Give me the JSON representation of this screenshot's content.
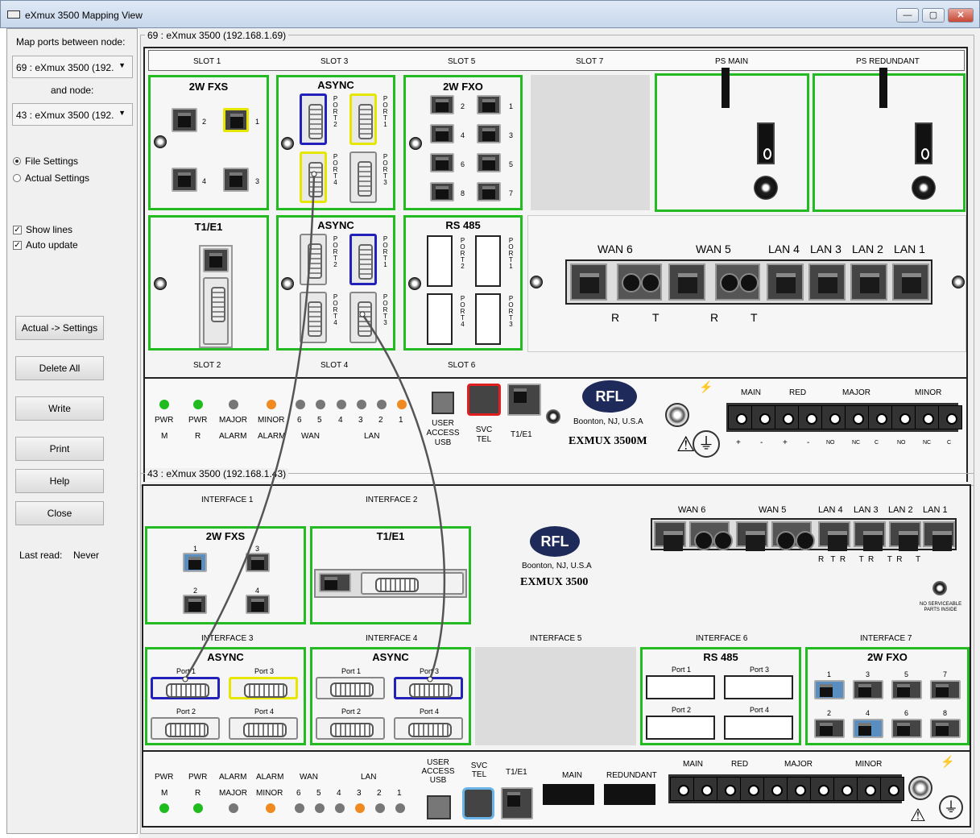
{
  "window": {
    "title": "eXmux 3500 Mapping View",
    "min": "—",
    "max": "▢",
    "close": "✕"
  },
  "left": {
    "map_label": "Map ports between node:",
    "node1": "69 : eXmux 3500 (192.",
    "and_label": "and node:",
    "node2": "43 : eXmux 3500 (192.",
    "radio_file": "File Settings",
    "radio_actual": "Actual Settings",
    "show_lines": "Show lines",
    "auto_update": "Auto update",
    "btn_actual": "Actual -> Settings",
    "btn_delete": "Delete All",
    "btn_write": "Write",
    "btn_print": "Print",
    "btn_help": "Help",
    "btn_close": "Close",
    "last_read_label": "Last read:",
    "last_read_value": "Never"
  },
  "top": {
    "group": "69 : eXmux 3500 (192.168.1.69)",
    "slots": {
      "s1": "SLOT 1",
      "s3": "SLOT 3",
      "s5": "SLOT 5",
      "s7": "SLOT 7",
      "ps_main": "PS MAIN",
      "ps_red": "PS REDUNDANT",
      "s2": "SLOT 2",
      "s4": "SLOT 4",
      "s6": "SLOT 6"
    },
    "cards": {
      "fxs": "2W FXS",
      "async1": "ASYNC",
      "fxo": "2W FXO",
      "t1e1": "T1/E1",
      "async2": "ASYNC",
      "rs485": "RS 485"
    },
    "fxs_ports": [
      "2",
      "1",
      "4",
      "3"
    ],
    "fxo_ports": [
      "2",
      "1",
      "4",
      "3",
      "6",
      "5",
      "8",
      "7"
    ],
    "port_labels": {
      "p2": "PORT2",
      "p1": "PORT1",
      "p4": "PORT4",
      "p3": "PORT3"
    },
    "wan": {
      "wan6": "WAN 6",
      "wan5": "WAN 5",
      "lan4": "LAN 4",
      "lan3": "LAN 3",
      "lan2": "LAN 2",
      "lan1": "LAN 1",
      "r": "R",
      "t": "T"
    },
    "leds": {
      "pwr": "PWR",
      "m": "M",
      "r": "R",
      "major": "MAJOR",
      "minor": "MINOR",
      "alarm": "ALARM",
      "wan": "WAN",
      "lan": "LAN",
      "n6": "6",
      "n5": "5",
      "n4": "4",
      "n3": "3",
      "n2": "2",
      "n1": "1"
    },
    "usb": "USER ACCESS USB",
    "svc": "SVC TEL",
    "t1": "T1/E1",
    "rfl": "RFL",
    "boonton": "Boonton, NJ, U.S.A",
    "model": "EXMUX 3500M",
    "alarm": {
      "main": "MAIN",
      "red": "RED",
      "major": "MAJOR",
      "minor": "MINOR",
      "plus": "+",
      "minus": "-",
      "no": "NO",
      "nc": "NC",
      "c": "C"
    }
  },
  "bottom": {
    "group": "43 : eXmux 3500 (192.168.1.43)",
    "ifs": {
      "i1": "INTERFACE 1",
      "i2": "INTERFACE 2",
      "i3": "INTERFACE 3",
      "i4": "INTERFACE 4",
      "i5": "INTERFACE 5",
      "i6": "INTERFACE 6",
      "i7": "INTERFACE 7"
    },
    "cards": {
      "fxs": "2W FXS",
      "t1e1": "T1/E1",
      "async3": "ASYNC",
      "async4": "ASYNC",
      "rs485": "RS 485",
      "fxo": "2W FXO"
    },
    "fxs_ports": [
      "1",
      "3",
      "2",
      "4"
    ],
    "ports": {
      "p1": "Port 1",
      "p2": "Port 2",
      "p3": "Port 3",
      "p4": "Port 4"
    },
    "fxo_ports": [
      "1",
      "3",
      "5",
      "7",
      "2",
      "4",
      "6",
      "8"
    ],
    "rfl": "RFL",
    "boonton": "Boonton, NJ, U.S.A",
    "model": "EXMUX 3500",
    "nsp": "NO SERVICEABLE PARTS INSIDE",
    "wan": {
      "wan6": "WAN 6",
      "wan5": "WAN 5",
      "lan4": "LAN 4",
      "lan3": "LAN 3",
      "lan2": "LAN 2",
      "lan1": "LAN 1",
      "rt": "R   T  R      T  R      T  R      T"
    },
    "leds": {
      "pwr": "PWR",
      "alarm": "ALARM",
      "wan": "WAN",
      "lan": "LAN",
      "m": "M",
      "r": "R",
      "major": "MAJOR",
      "minor": "MINOR",
      "n6": "6",
      "n5": "5",
      "n4": "4",
      "n3": "3",
      "n2": "2",
      "n1": "1"
    },
    "usb": "USER ACCESS USB",
    "svc": "SVC TEL",
    "t1": "T1/E1",
    "main": "MAIN",
    "redundant": "REDUNDANT",
    "alarm": {
      "main": "MAIN",
      "red": "RED",
      "major": "MAJOR",
      "minor": "MINOR"
    }
  }
}
